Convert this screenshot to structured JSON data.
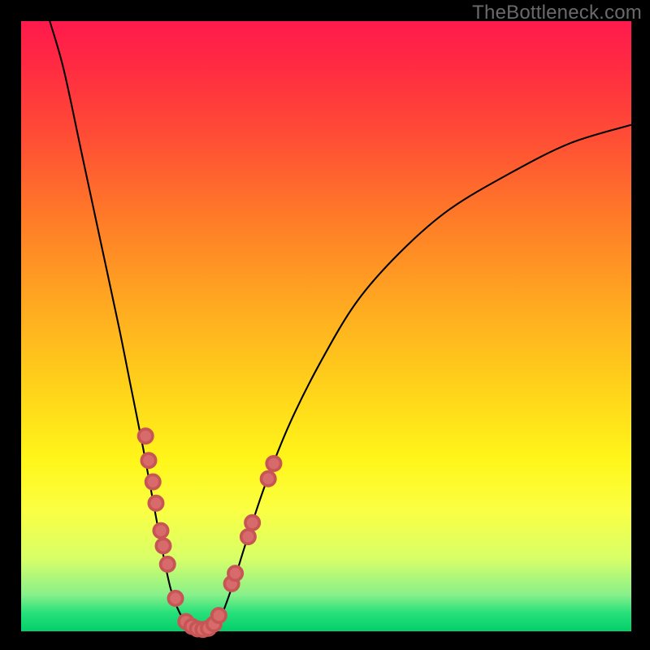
{
  "watermark": "TheBottleneck.com",
  "chart_data": {
    "type": "line",
    "title": "",
    "xlabel": "",
    "ylabel": "",
    "x_range": [
      0,
      100
    ],
    "y_range": [
      0,
      100
    ],
    "curve_points": [
      {
        "x": 4.7,
        "y": 100
      },
      {
        "x": 7.0,
        "y": 92
      },
      {
        "x": 10.0,
        "y": 78
      },
      {
        "x": 13.0,
        "y": 64
      },
      {
        "x": 16.0,
        "y": 50
      },
      {
        "x": 18.0,
        "y": 40
      },
      {
        "x": 20.0,
        "y": 30
      },
      {
        "x": 21.5,
        "y": 22
      },
      {
        "x": 23.0,
        "y": 14
      },
      {
        "x": 24.5,
        "y": 7
      },
      {
        "x": 26.0,
        "y": 3
      },
      {
        "x": 27.5,
        "y": 1
      },
      {
        "x": 29.0,
        "y": 0.2
      },
      {
        "x": 30.5,
        "y": 0.2
      },
      {
        "x": 31.8,
        "y": 1
      },
      {
        "x": 33.0,
        "y": 3
      },
      {
        "x": 34.8,
        "y": 8
      },
      {
        "x": 37.0,
        "y": 15
      },
      {
        "x": 40.0,
        "y": 24
      },
      {
        "x": 44.0,
        "y": 34
      },
      {
        "x": 49.0,
        "y": 44
      },
      {
        "x": 55.0,
        "y": 54
      },
      {
        "x": 62.0,
        "y": 62
      },
      {
        "x": 70.0,
        "y": 69
      },
      {
        "x": 80.0,
        "y": 75
      },
      {
        "x": 90.0,
        "y": 80
      },
      {
        "x": 100.0,
        "y": 83
      }
    ],
    "dots": [
      {
        "x": 20.4,
        "y": 32.0
      },
      {
        "x": 20.9,
        "y": 28.0
      },
      {
        "x": 21.6,
        "y": 24.5
      },
      {
        "x": 22.1,
        "y": 21.0
      },
      {
        "x": 22.9,
        "y": 16.5
      },
      {
        "x": 23.3,
        "y": 14.0
      },
      {
        "x": 24.0,
        "y": 11.0
      },
      {
        "x": 25.3,
        "y": 5.4
      },
      {
        "x": 27.0,
        "y": 1.6
      },
      {
        "x": 28.0,
        "y": 0.8
      },
      {
        "x": 28.9,
        "y": 0.4
      },
      {
        "x": 29.8,
        "y": 0.3
      },
      {
        "x": 30.7,
        "y": 0.5
      },
      {
        "x": 31.6,
        "y": 1.2
      },
      {
        "x": 32.4,
        "y": 2.6
      },
      {
        "x": 34.5,
        "y": 7.8
      },
      {
        "x": 35.1,
        "y": 9.5
      },
      {
        "x": 37.2,
        "y": 15.5
      },
      {
        "x": 37.9,
        "y": 17.8
      },
      {
        "x": 40.5,
        "y": 25.0
      },
      {
        "x": 41.4,
        "y": 27.5
      }
    ],
    "dot_radius": 1.15,
    "colors": {
      "curve": "#000000",
      "dot_fill": "#d76b6c",
      "dot_stroke": "#c85556",
      "gradient_top": "#ff1a4d",
      "gradient_bottom": "#04cf6a"
    }
  }
}
